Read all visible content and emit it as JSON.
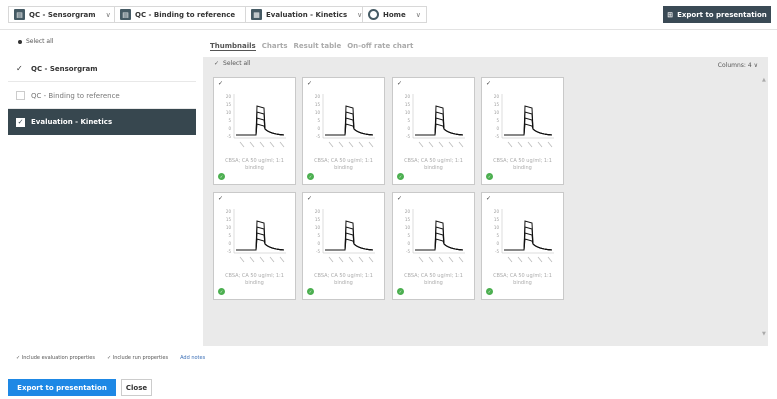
{
  "toolbar": {
    "items": [
      {
        "label": "QC - Sensorgram",
        "icon": "doc-icon"
      },
      {
        "label": "QC - Binding to reference",
        "icon": "doc-icon"
      },
      {
        "label": "Evaluation - Kinetics",
        "icon": "chart-icon"
      },
      {
        "label": "Home",
        "icon": "circle-icon"
      }
    ],
    "export_label": "Export to presentation"
  },
  "left": {
    "select_all": "Select all",
    "items": [
      {
        "label": "QC - Sensorgram"
      },
      {
        "label": "QC - Binding to reference"
      },
      {
        "label": "Evaluation - Kinetics"
      }
    ]
  },
  "tabs": [
    "Thumbnails",
    "Charts",
    "Result table",
    "On-off rate chart"
  ],
  "main": {
    "select_all": "Select all",
    "columns_label": "Columns:",
    "columns_value": "4",
    "card_caption_line1": "CBSA; CA 50 ug/ml; 1:1",
    "card_caption_line2": "binding",
    "y_ticks": [
      "20",
      "15",
      "10",
      "5",
      "0",
      "-5"
    ]
  },
  "bottom": {
    "include_eval": "Include evaluation properties",
    "include_run": "Include run properties",
    "add_notes": "Add notes",
    "export_label": "Export to presentation",
    "close_label": "Close"
  },
  "colors": {
    "dark": "#37474f",
    "accent": "#1e88e5",
    "success": "#4caf50"
  }
}
